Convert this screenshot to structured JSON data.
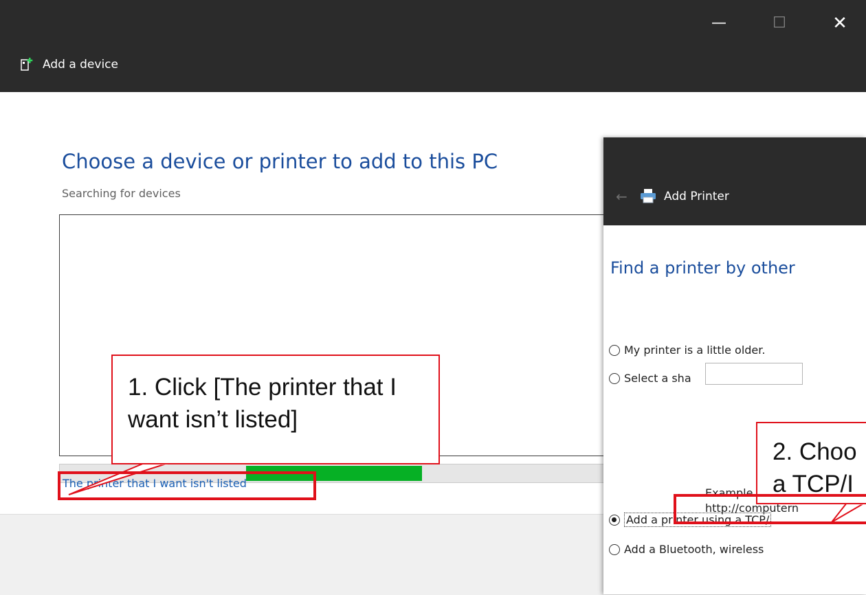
{
  "add_device_window": {
    "title": "Add a device",
    "controls": {
      "minimize": "—",
      "maximize": "☐",
      "close": "✕"
    },
    "heading": "Choose a device or printer to add to this PC",
    "status": "Searching for devices",
    "progress_fraction": 0.28,
    "link_not_listed": "The printer that I want isn't listed"
  },
  "add_printer_window": {
    "back": "←",
    "title": "Add Printer",
    "heading": "Find a printer by other",
    "options": [
      {
        "label": "My printer is a little older.",
        "checked": false
      },
      {
        "label": "Select a sha",
        "checked": false
      },
      {
        "label": "Add a printer using a TCP/",
        "checked": true
      },
      {
        "label": "Add a Bluetooth, wireless",
        "checked": false
      }
    ],
    "example_line1": "Example",
    "example_line2": "http://computern"
  },
  "annotations": {
    "callout1": "1. Click [The printer that I want isn’t listed]",
    "callout2": "2. Choo a TCP/I"
  },
  "colors": {
    "titlebar": "#2b2b2b",
    "heading_blue": "#1a4d9c",
    "link_blue": "#1a5fb4",
    "progress_green": "#06b025",
    "annotation_red": "#e0101a"
  }
}
